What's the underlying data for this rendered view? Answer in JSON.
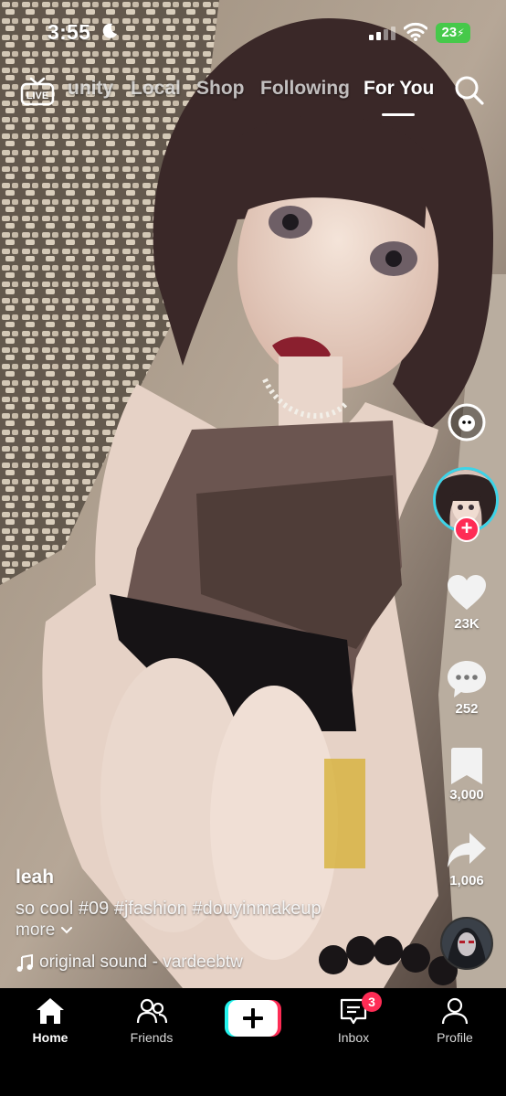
{
  "status_bar": {
    "time": "3:55",
    "battery": "23"
  },
  "top_tabs": [
    {
      "label": "unity"
    },
    {
      "label": "Local"
    },
    {
      "label": "Shop"
    },
    {
      "label": "Following"
    },
    {
      "label": "For You",
      "active": true
    }
  ],
  "live_icon": {
    "text": "LIVE",
    "icon": "live-tv-icon"
  },
  "rail": {
    "likes": "23K",
    "comments": "252",
    "saves": "3,000",
    "shares": "1,006"
  },
  "post": {
    "username": "leah",
    "caption": "so cool #09 #jfashion #douyinmakeup",
    "more": "more",
    "sound": "original sound - vardeebtw"
  },
  "nav": {
    "home": "Home",
    "friends": "Friends",
    "inbox": "Inbox",
    "inbox_badge": "3",
    "profile": "Profile"
  },
  "colors": {
    "accent_red": "#fe2c55",
    "accent_cyan": "#25f4ee",
    "battery_green": "#46c94a"
  }
}
